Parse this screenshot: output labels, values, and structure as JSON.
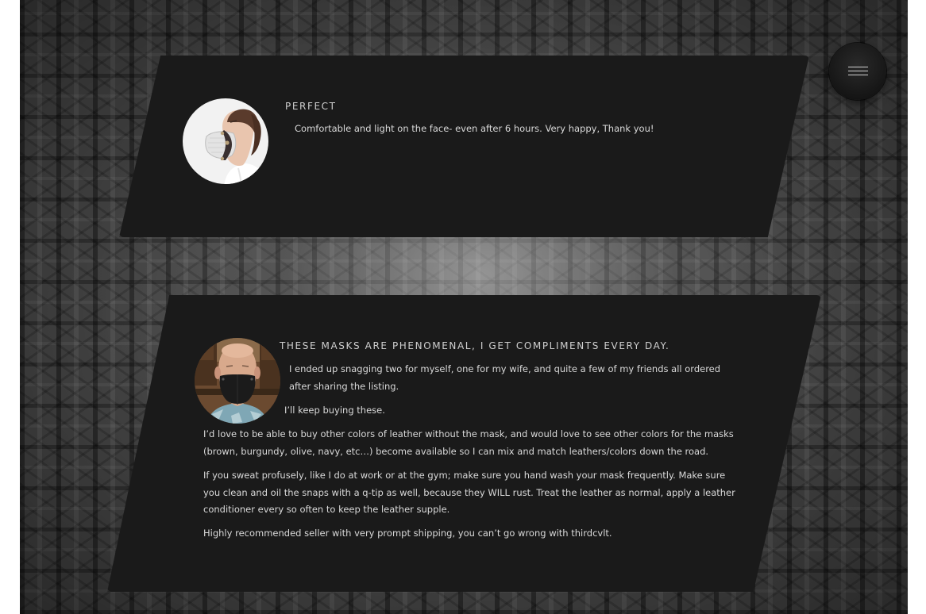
{
  "menu": {
    "icon": "hamburger-menu-icon",
    "label": "Menu"
  },
  "testimonials": [
    {
      "avatar_icon": "reviewer-photo-woman-in-mask",
      "title": "PERFECT",
      "paragraphs": [
        "Comfortable and light on the face- even after 6 hours. Very happy, Thank you!"
      ]
    },
    {
      "avatar_icon": "reviewer-photo-man-in-mask",
      "title": "THESE MASKS ARE PHENOMENAL, I GET COMPLIMENTS EVERY DAY.",
      "paragraphs": [
        "I ended up snagging two for myself, one for my wife, and quite a few of my friends all ordered after sharing the listing.",
        "I’ll keep buying these.",
        "I’d love to be able to buy other colors of leather without the mask, and would love to see other colors for the masks (brown, burgundy, olive, navy, etc…) become available so I can mix and match leathers/colors down the road.",
        "If you sweat profusely, like I do at work or at the gym; make sure you hand wash your mask frequently. Make sure you clean and oil the snaps with a q-tip as well, because they WILL rust. Treat the leather as normal, apply a leather conditioner every so often to keep the leather supple.",
        "Highly recommended seller with very prompt shipping, you can’t go wrong with thirdcvlt."
      ]
    }
  ],
  "colors": {
    "card_background": "#1a1a1a",
    "text": "#d9d9d9",
    "title": "#cfcfcf"
  }
}
